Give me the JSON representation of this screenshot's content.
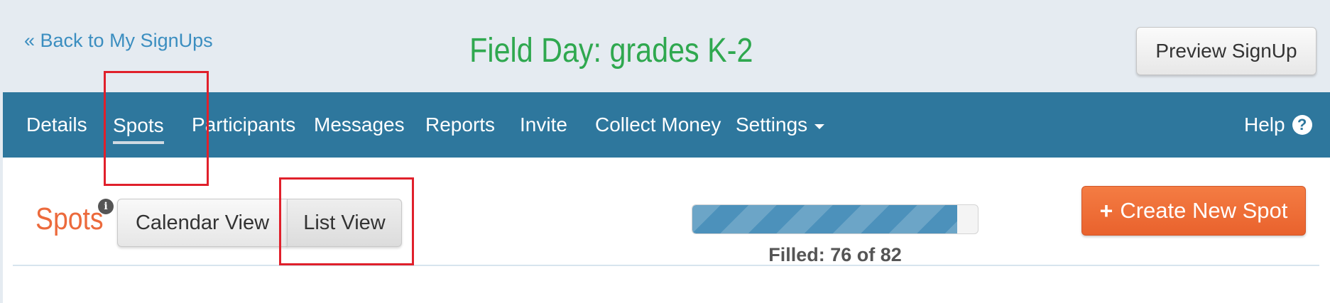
{
  "header": {
    "back_link": "« Back to My SignUps",
    "title": "Field Day: grades K-2",
    "preview_button": "Preview SignUp"
  },
  "nav": {
    "items": [
      {
        "label": "Details"
      },
      {
        "label": "Spots",
        "active": true
      },
      {
        "label": "Participants"
      },
      {
        "label": "Messages"
      },
      {
        "label": "Reports"
      },
      {
        "label": "Invite"
      },
      {
        "label": "Collect Money"
      },
      {
        "label": "Settings",
        "has_dropdown": true
      }
    ],
    "help_label": "Help",
    "help_icon": "question-circle-icon"
  },
  "spots": {
    "heading": "Spots",
    "info_icon": "info-icon",
    "view_buttons": {
      "calendar": "Calendar View",
      "list": "List View"
    },
    "progress": {
      "filled": 76,
      "total": 82,
      "label": "Filled: 76 of 82"
    },
    "create_button": {
      "plus": "+",
      "label": "Create New Spot"
    }
  },
  "colors": {
    "nav_background": "#2e779d",
    "title_green": "#2fa84f",
    "accent_orange": "#ec6a3c",
    "create_button": "#f0703a",
    "link_blue": "#3b8ec0",
    "progress_fill": "#4c91bb",
    "highlight_red": "#e0202b"
  }
}
